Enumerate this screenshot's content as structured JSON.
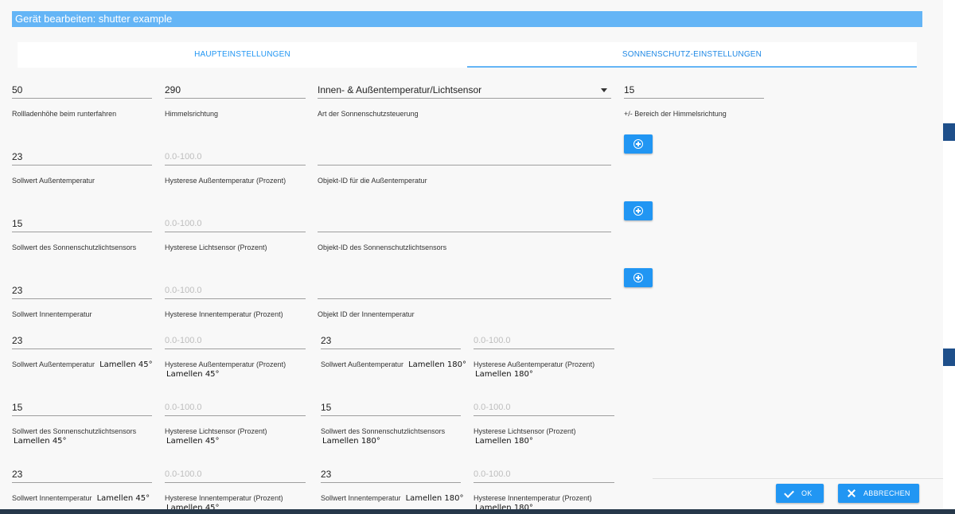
{
  "dialog": {
    "title": "Gerät bearbeiten: shutter example"
  },
  "tabs": [
    {
      "label": "HAUPTEINSTELLUNGEN"
    },
    {
      "label": "SONNENSCHUTZ-EINSTELLUNGEN",
      "active": true
    }
  ],
  "row1": {
    "height": {
      "value": "50",
      "label": "Rollladenhöhe beim runterfahren"
    },
    "direction": {
      "value": "290",
      "label": "Himmelsrichtung"
    },
    "type": {
      "value": "Innen- & Außentemperatur/Lichtsensor",
      "label": "Art der Sonnenschutzsteuerung"
    },
    "range": {
      "value": "15",
      "label": "+/- Bereich der Himmelsrichtung"
    }
  },
  "row2": {
    "setpoint": {
      "value": "23",
      "label": "Sollwert Außentemperatur"
    },
    "hysteresis": {
      "placeholder": "0.0-100.0",
      "label": "Hysterese Außentemperatur (Prozent)"
    },
    "object": {
      "value": "",
      "label": "Objekt-ID für die Außentemperatur"
    }
  },
  "row3": {
    "setpoint": {
      "value": "15",
      "label": "Sollwert des Sonnenschutzlichtsensors"
    },
    "hysteresis": {
      "placeholder": "0.0-100.0",
      "label": "Hysterese Lichtsensor (Prozent)"
    },
    "object": {
      "value": "",
      "label": "Objekt-ID des Sonnenschutzlichtsensors"
    }
  },
  "row4": {
    "setpoint": {
      "value": "23",
      "label": "Sollwert Innentemperatur"
    },
    "hysteresis": {
      "placeholder": "0.0-100.0",
      "label": "Hysterese Innentemperatur (Prozent)"
    },
    "object": {
      "value": "",
      "label": "Objekt ID der Innentemperatur"
    }
  },
  "slats": {
    "outer45": {
      "value": "23",
      "label": "Sollwert Außentemperatur",
      "note": "Lamellen 45°"
    },
    "outer45_hyst": {
      "placeholder": "0.0-100.0",
      "label": "Hysterese Außentemperatur (Prozent)",
      "note": "Lamellen 45°"
    },
    "outer180": {
      "value": "23",
      "label": "Sollwert Außentemperatur",
      "note": "Lamellen 180°"
    },
    "outer180_hyst": {
      "placeholder": "0.0-100.0",
      "label": "Hysterese Außentemperatur (Prozent)",
      "note": "Lamellen 180°"
    },
    "light45": {
      "value": "15",
      "label": "Sollwert des Sonnenschutzlichtsensors",
      "note": "Lamellen 45°"
    },
    "light45_hyst": {
      "placeholder": "0.0-100.0",
      "label": "Hysterese Lichtsensor (Prozent)",
      "note": "Lamellen 45°"
    },
    "light180": {
      "value": "15",
      "label": "Sollwert des Sonnenschutzlichtsensors",
      "note": "Lamellen 180°"
    },
    "light180_hyst": {
      "placeholder": "0.0-100.0",
      "label": "Hysterese Lichtsensor (Prozent)",
      "note": "Lamellen 180°"
    },
    "inner45": {
      "value": "23",
      "label": "Sollwert Innentemperatur",
      "note": "Lamellen 45°"
    },
    "inner45_hyst": {
      "placeholder": "0.0-100.0",
      "label": "Hysterese Innentemperatur (Prozent)",
      "note": "Lamellen 45°"
    },
    "inner180": {
      "value": "23",
      "label": "Sollwert Innentemperatur",
      "note": "Lamellen 180°"
    },
    "inner180_hyst": {
      "placeholder": "0.0-100.0",
      "label": "Hysterese Innentemperatur (Prozent)",
      "note": "Lamellen 180°"
    }
  },
  "buttons": {
    "ok": "OK",
    "cancel": "ABBRECHEN"
  },
  "icons": {
    "add": "plus-circle-icon",
    "ok": "check-icon",
    "cancel": "close-icon",
    "dropdown": "caret-down-icon"
  },
  "colors": {
    "primary": "#2196f3",
    "titlebar": "#64b5f6"
  }
}
